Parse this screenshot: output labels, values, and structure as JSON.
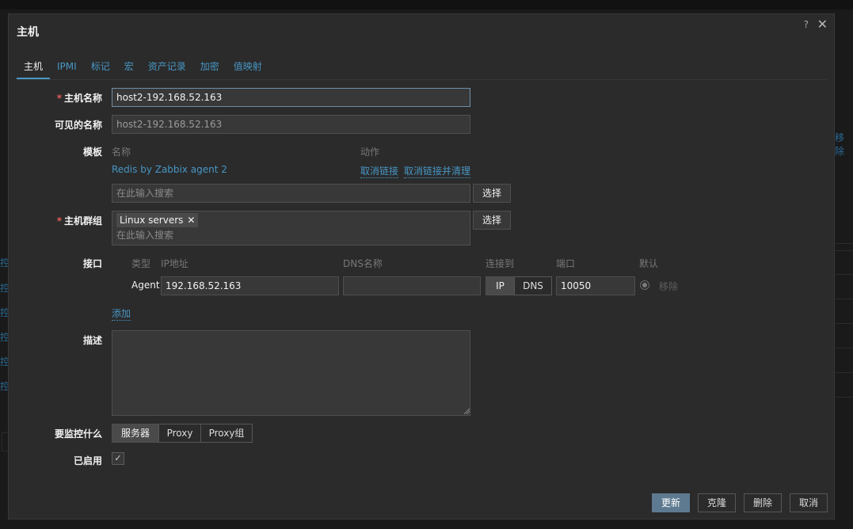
{
  "background": {
    "side_words": [
      "控",
      "控",
      "控",
      "控",
      "控",
      "控"
    ],
    "remove_link": "移除"
  },
  "dialog": {
    "title": "主机",
    "help": "?",
    "close": "✕"
  },
  "tabs": [
    {
      "label": "主机",
      "active": true
    },
    {
      "label": "IPMI"
    },
    {
      "label": "标记"
    },
    {
      "label": "宏"
    },
    {
      "label": "资产记录"
    },
    {
      "label": "加密"
    },
    {
      "label": "值映射"
    }
  ],
  "form": {
    "host_name": {
      "label": "主机名称",
      "value": "host2-192.168.52.163"
    },
    "visible_name": {
      "label": "可见的名称",
      "value": "host2-192.168.52.163"
    },
    "templates": {
      "label": "模板",
      "col_name": "名称",
      "col_action": "动作",
      "items": [
        {
          "name": "Redis by Zabbix agent 2",
          "unlink": "取消链接",
          "unlink_clear": "取消链接并清理"
        }
      ],
      "search_placeholder": "在此输入搜索",
      "select_button": "选择"
    },
    "host_groups": {
      "label": "主机群组",
      "chips": [
        "Linux servers"
      ],
      "chip_remove": "✕",
      "search_placeholder": "在此输入搜索",
      "select_button": "选择"
    },
    "interfaces": {
      "label": "接口",
      "headers": {
        "type": "类型",
        "ip": "IP地址",
        "dns": "DNS名称",
        "connect_to": "连接到",
        "port": "端口",
        "default": "默认"
      },
      "rows": [
        {
          "type": "Agent",
          "ip": "192.168.52.163",
          "dns": "",
          "connect_ip": "IP",
          "connect_dns": "DNS",
          "port": "10050",
          "remove": "移除"
        }
      ],
      "add": "添加"
    },
    "description": {
      "label": "描述",
      "value": ""
    },
    "monitored_by": {
      "label": "要监控什么",
      "options": [
        "服务器",
        "Proxy",
        "Proxy组"
      ],
      "selected": "服务器"
    },
    "enabled": {
      "label": "已启用",
      "checked": true,
      "mark": "✓"
    }
  },
  "footer": {
    "update": "更新",
    "clone": "克隆",
    "delete": "删除",
    "cancel": "取消"
  },
  "colors": {
    "accent": "#4796c4",
    "required": "#e45959",
    "primary_button": "#5d7a90",
    "dialog_bg": "#2b2b2b"
  }
}
